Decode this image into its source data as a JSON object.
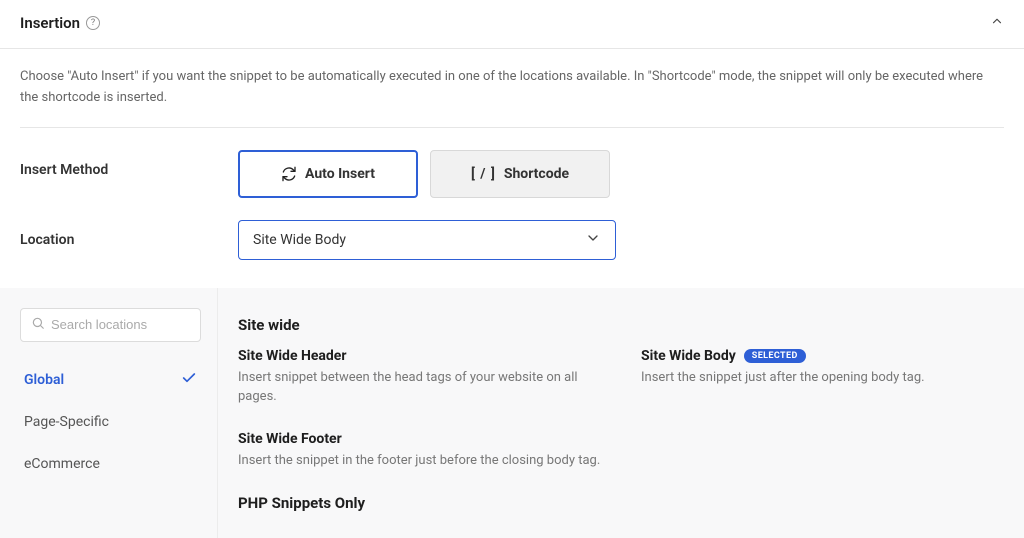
{
  "panel": {
    "title": "Insertion",
    "description": "Choose \"Auto Insert\" if you want the snippet to be automatically executed in one of the locations available. In \"Shortcode\" mode, the snippet will only be executed where the shortcode is inserted."
  },
  "labels": {
    "insert_method": "Insert Method",
    "location": "Location"
  },
  "methods": {
    "auto": "Auto Insert",
    "shortcode": "Shortcode",
    "shortcode_glyph": "[ / ]"
  },
  "location_select": {
    "value": "Site Wide Body"
  },
  "search": {
    "placeholder": "Search locations"
  },
  "categories": {
    "global": "Global",
    "page_specific": "Page-Specific",
    "ecommerce": "eCommerce"
  },
  "groups": {
    "site_wide": "Site wide",
    "php_only": "PHP Snippets Only"
  },
  "locations": {
    "header": {
      "name": "Site Wide Header",
      "desc": "Insert snippet between the head tags of your website on all pages."
    },
    "body": {
      "name": "Site Wide Body",
      "desc": "Insert the snippet just after the opening body tag.",
      "badge": "SELECTED"
    },
    "footer": {
      "name": "Site Wide Footer",
      "desc": "Insert the snippet in the footer just before the closing body tag."
    }
  }
}
